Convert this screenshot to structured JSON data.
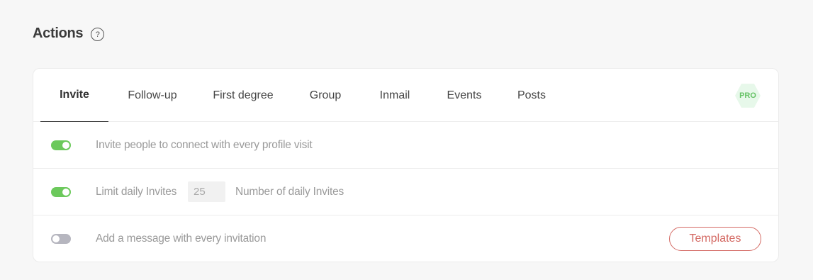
{
  "header": {
    "title": "Actions",
    "help_icon": "?"
  },
  "tabs": [
    {
      "label": "Invite",
      "active": true
    },
    {
      "label": "Follow-up",
      "active": false
    },
    {
      "label": "First degree",
      "active": false
    },
    {
      "label": "Group",
      "active": false
    },
    {
      "label": "Inmail",
      "active": false
    },
    {
      "label": "Events",
      "active": false
    },
    {
      "label": "Posts",
      "active": false
    }
  ],
  "pro_badge": "PRO",
  "rows": {
    "invite_on_visit": {
      "toggle_on": true,
      "label": "Invite people to connect with every profile visit"
    },
    "limit_daily": {
      "toggle_on": true,
      "label": "Limit daily Invites",
      "input_value": "25",
      "suffix_label": "Number of daily Invites"
    },
    "add_message": {
      "toggle_on": false,
      "label": "Add a message with every invitation",
      "button_label": "Templates"
    }
  },
  "colors": {
    "toggle_on": "#6cc95c",
    "toggle_off": "#b6b6bf",
    "accent_red": "#d46a64",
    "pro_green": "#66c266"
  }
}
